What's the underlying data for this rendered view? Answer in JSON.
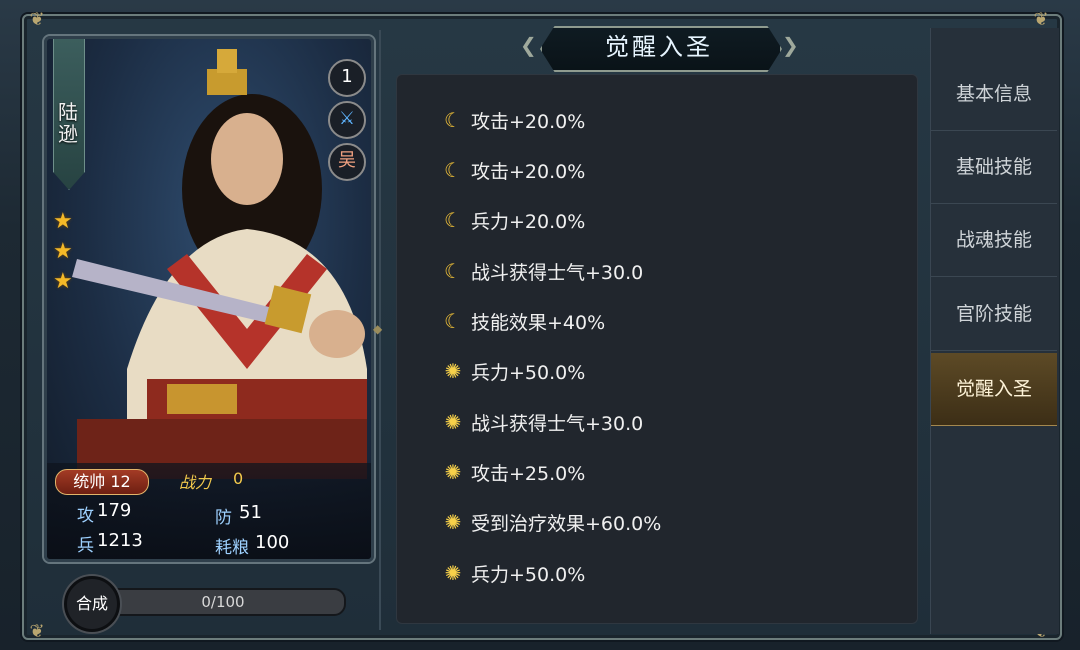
{
  "hero": {
    "name": "陆逊",
    "level": "1",
    "class_icon": "bow-icon",
    "faction": "吴",
    "stars": 3,
    "rank_label": "统帅 12",
    "combat_label": "战力",
    "combat_value": "0",
    "stats": {
      "atk_label": "攻",
      "atk_value": "179",
      "def_label": "防",
      "def_value": "51",
      "troop_label": "兵",
      "troop_value": "1213",
      "food_label": "耗粮",
      "food_value": "100"
    }
  },
  "merge": {
    "button_label": "合成",
    "progress_text": "0/100",
    "progress": 0
  },
  "title": "觉醒入圣",
  "bonuses": [
    {
      "icon": "moon-icon",
      "text": "攻击+20.0%"
    },
    {
      "icon": "moon-icon",
      "text": "攻击+20.0%"
    },
    {
      "icon": "moon-icon",
      "text": "兵力+20.0%"
    },
    {
      "icon": "moon-icon",
      "text": "战斗获得士气+30.0"
    },
    {
      "icon": "moon-icon",
      "text": "技能效果+40%"
    },
    {
      "icon": "sun-icon",
      "text": "兵力+50.0%"
    },
    {
      "icon": "sun-icon",
      "text": "战斗获得士气+30.0"
    },
    {
      "icon": "sun-icon",
      "text": "攻击+25.0%"
    },
    {
      "icon": "sun-icon",
      "text": "受到治疗效果+60.0%"
    },
    {
      "icon": "sun-icon",
      "text": "兵力+50.0%"
    }
  ],
  "tabs": [
    {
      "label": "基本信息",
      "active": false
    },
    {
      "label": "基础技能",
      "active": false
    },
    {
      "label": "战魂技能",
      "active": false
    },
    {
      "label": "官阶技能",
      "active": false
    },
    {
      "label": "觉醒入圣",
      "active": true
    }
  ],
  "colors": {
    "accent_gold": "#f2c94c",
    "tab_active": "#5d4a26",
    "stat_blue": "#9ed1ff"
  }
}
